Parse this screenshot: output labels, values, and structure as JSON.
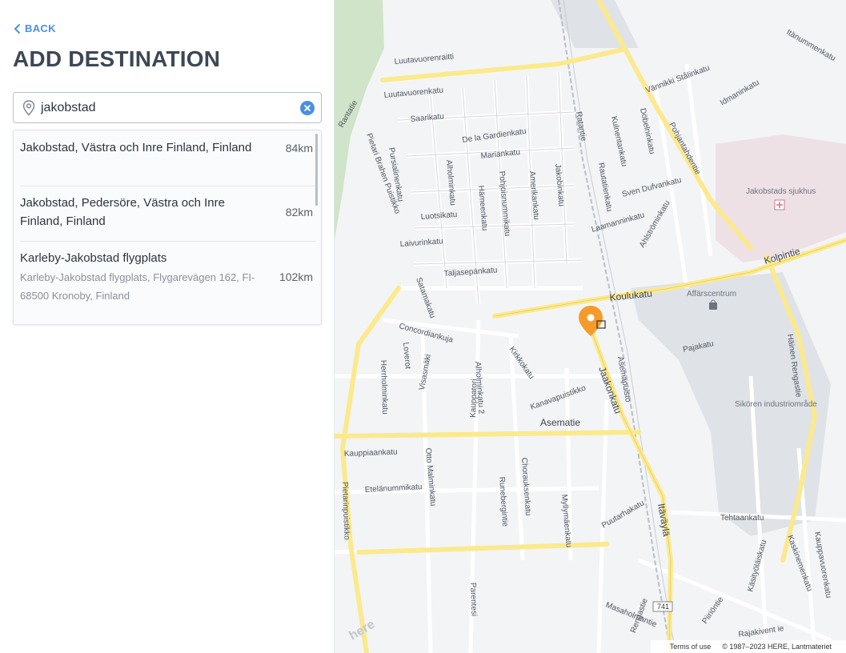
{
  "back_label": "BACK",
  "page_title": "ADD DESTINATION",
  "search": {
    "value": "jakobstad",
    "placeholder": ""
  },
  "results": [
    {
      "name": "Jakobstad, Västra och Inre Finland, Finland",
      "distance": "84km"
    },
    {
      "name": "Jakobstad, Pedersöre, Västra och Inre Finland, Finland",
      "distance": "82km"
    },
    {
      "name": "Karleby-Jakobstad flygplats",
      "address": "Karleby-Jakobstad flygplats, Flygarevägen 162, FI-68500 Kronoby, Finland",
      "distance": "102km"
    }
  ],
  "map": {
    "streets": [
      "Luutavuorenraitti",
      "Luutavuorenkatu",
      "Saarikatu",
      "De la Gardienkatu",
      "Mariankatu",
      "Pursialinenkatu",
      "Alholminkatu",
      "Hämeenkatu",
      "Pohjoisnummikatu",
      "Amerikankatu",
      "Jakobinkatu",
      "Luotsikatu",
      "Laivurinkatu",
      "Taljasepänkatu",
      "Satamakatu",
      "Concordiankuja",
      "Kirkkokatu",
      "Kanavapuistikko",
      "Asematie",
      "Koulukatu",
      "Kolpintie",
      "Jaakonkatu",
      "Asemapuisto",
      "Pajakatu",
      "Häinen Rengastie",
      "Kauppiaankatu",
      "Otto Malminkatu",
      "Chorauksenkatu",
      "Runebergintie",
      "Myllymäenkatu",
      "Puutarhakatu",
      "Itäväylä",
      "Etelänummikatu",
      "Pietarinpuistikko",
      "Parentesi",
      "Masaholmantie",
      "Rengastie",
      "Piiriöntie",
      "Rajakivent ie",
      "Tehtaankatu",
      "Kaskinemenkatu",
      "Käsityöläiskatu",
      "Kauppavuorenkatu",
      "Ratantie",
      "Pohjantahdentie",
      "Döbelninkatu",
      "Kulnentankatu",
      "Sven Dufvankatu",
      "Laamanninkatu",
      "Ahlströminkatu",
      "Vännikki Stålinkatu",
      "Idmaninkatu",
      "Itänummenkatu",
      "Rantatie",
      "Pietari Brahen Puistikko",
      "Visasmäki",
      "Herrholminkatu",
      "Loverot",
      "Kauppatori",
      "Alholminkatu 2",
      "Rautatienkatu"
    ],
    "areas": [
      "Jakobstads sjukhus",
      "Affärscentrum",
      "Sikören industriområde"
    ],
    "road_shield": "741",
    "terms_label": "Terms of use",
    "copyright": "© 1987–2023 HERE, Lantmateriet",
    "logo_text": "here"
  },
  "colors": {
    "accent": "#4a90e2",
    "title": "#3d4756",
    "marker": "#f59b2a",
    "road_major": "#fbe98d",
    "hospital": "#ede1e6"
  }
}
